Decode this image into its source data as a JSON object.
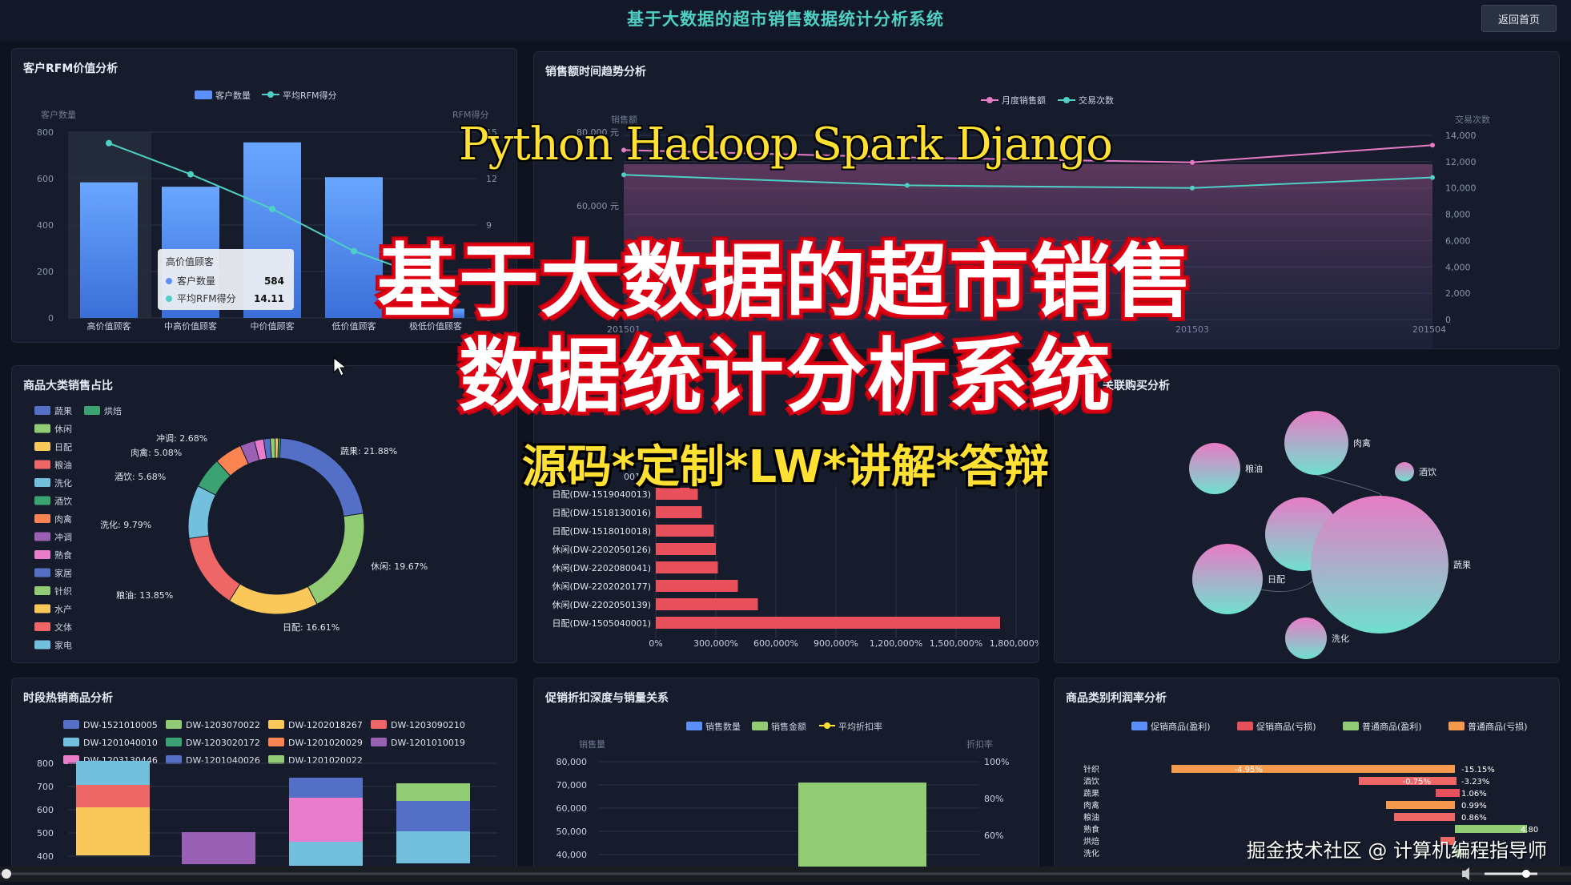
{
  "header": {
    "title": "基于大数据的超市销售数据统计分析系统",
    "home_button": "返回首页"
  },
  "panels": {
    "rfm": {
      "title": "客户RFM价值分析",
      "legend": [
        "客户数量",
        "平均RFM得分"
      ],
      "left_axis_name": "客户数量",
      "right_axis_name": "RFM得分",
      "left_ticks": [
        "800",
        "600",
        "400",
        "200",
        "0"
      ],
      "right_ticks": [
        "15",
        "12",
        "9",
        "6",
        "3"
      ],
      "tooltip": {
        "title": "高价值顾客",
        "row1_label": "客户数量",
        "row1_value": "584",
        "row2_label": "平均RFM得分",
        "row2_value": "14.11"
      }
    },
    "trend": {
      "title": "销售额时间趋势分析",
      "legend": [
        "月度销售额",
        "交易次数"
      ],
      "left_axis_name": "销售额",
      "right_axis_name": "交易次数",
      "left_ticks": [
        "80,000 元",
        "60,000 元"
      ],
      "right_ticks": [
        "14,000",
        "12,000",
        "10,000",
        "8,000",
        "6,000",
        "4,000",
        "2,000",
        "0"
      ],
      "x_ticks": [
        "201501",
        "201503",
        "201504"
      ]
    },
    "category": {
      "title": "商品大类销售占比",
      "legend": [
        "蔬果",
        "烘焙",
        "休闲",
        "日配",
        "粮油",
        "洗化",
        "酒饮",
        "肉禽",
        "冲调",
        "熟食",
        "家居",
        "针织",
        "水产",
        "文体",
        "家电"
      ],
      "labels": [
        "蔬果: 21.88%",
        "休闲: 19.67%",
        "日配: 16.61%",
        "粮油: 13.85%",
        "洗化: 9.79%",
        "酒饮: 5.68%",
        "肉禽: 5.08%",
        "冲调: 2.68%"
      ]
    },
    "top_products": {
      "title_suffix": "0013)",
      "x_ticks": [
        "0%",
        "300,000%",
        "600,000%",
        "900,000%",
        "1,200,000%",
        "1,500,000%",
        "1,800,000%"
      ]
    },
    "bubble": {
      "title": "关联购买分析"
    },
    "hot": {
      "title": "时段热销商品分析",
      "legend": [
        "DW-1521010005",
        "DW-1203070022",
        "DW-1202018267",
        "DW-1203090210",
        "DW-1201040010",
        "DW-1203020172",
        "DW-1201020029",
        "DW-1201010019",
        "DW-1203130446",
        "DW-1201040026",
        "DW-1201020022"
      ],
      "y_ticks": [
        "800",
        "700",
        "600",
        "500",
        "400"
      ]
    },
    "promo": {
      "title": "促销折扣深度与销量关系",
      "legend": [
        "销售数量",
        "销售金额",
        "平均折扣率"
      ],
      "left_axis_name": "销售量",
      "right_axis_name": "折扣率",
      "left_ticks": [
        "80,000",
        "70,000",
        "60,000",
        "50,000",
        "40,000"
      ],
      "right_ticks": [
        "100%",
        "80%",
        "60%"
      ]
    },
    "profit": {
      "title": "商品类别利润率分析",
      "legend": [
        "促销商品(盈利)",
        "促销商品(亏损)",
        "普通商品(盈利)",
        "普通商品(亏损)"
      ],
      "categories": [
        "针织",
        "酒饮",
        "蔬果",
        "肉禽",
        "粮油",
        "熟食",
        "烘焙",
        "洗化"
      ],
      "labels": [
        "-4.95%",
        "-15.15%",
        "-0.75%",
        "-3.23%",
        "1.06%",
        "0.99%",
        "0.86%",
        "4.80"
      ]
    }
  },
  "chart_data": [
    {
      "type": "bar",
      "title": "客户RFM价值分析",
      "categories": [
        "高价值顾客",
        "中高价值顾客",
        "中价值顾客",
        "低价值顾客",
        "极低价值顾客"
      ],
      "series": [
        {
          "name": "客户数量",
          "values": [
            584,
            565,
            756,
            606,
            40
          ]
        },
        {
          "name": "平均RFM得分",
          "values": [
            14.11,
            11.6,
            8.8,
            5.4,
            3.0
          ]
        }
      ],
      "ylim": [
        0,
        800
      ],
      "ylim_right": [
        0,
        15
      ]
    },
    {
      "type": "line",
      "title": "销售额时间趋势分析",
      "x": [
        "201501",
        "201502",
        "201503",
        "201504"
      ],
      "series": [
        {
          "name": "月度销售额",
          "values": [
            84000,
            81000,
            79000,
            86000
          ]
        },
        {
          "name": "交易次数",
          "values": [
            11000,
            10200,
            10000,
            10800
          ]
        }
      ]
    },
    {
      "type": "pie",
      "title": "商品大类销售占比",
      "categories": [
        "蔬果",
        "休闲",
        "日配",
        "粮油",
        "洗化",
        "酒饮",
        "肉禽",
        "冲调",
        "熟食",
        "家居",
        "针织",
        "水产",
        "烘焙"
      ],
      "values": [
        21.88,
        19.67,
        16.61,
        13.85,
        9.79,
        5.68,
        5.08,
        2.68,
        1.7,
        1.2,
        0.9,
        0.6,
        0.4
      ]
    },
    {
      "type": "bar",
      "categories": [
        "日配(DW-1519040013)",
        "日配(DW-1518130016)",
        "日配(DW-1518010018)",
        "休闲(DW-2202050126)",
        "休闲(DW-2202080041)",
        "休闲(DW-2202020177)",
        "休闲(DW-2202050139)",
        "日配(DW-1505040001)"
      ],
      "values": [
        210000,
        230000,
        290000,
        300000,
        310000,
        410000,
        510000,
        1720000
      ],
      "xlim": [
        0,
        1800000
      ]
    },
    {
      "type": "scatter",
      "title": "关联购买分析",
      "categories": [
        "肉禽",
        "粮油",
        "酒饮",
        "休闲",
        "日配",
        "蔬果",
        "洗化"
      ],
      "values": [
        0.5,
        0.55,
        0.3,
        0.46,
        0.6,
        0.57,
        0.54
      ]
    },
    {
      "type": "bar",
      "title": "时段热销商品分析",
      "ylim": [
        400,
        800
      ]
    },
    {
      "type": "bar",
      "title": "促销折扣深度与销量关系",
      "series": [
        {
          "name": "销售金额",
          "values": [
            71000
          ]
        }
      ],
      "ylim": [
        40000,
        80000
      ]
    },
    {
      "type": "bar",
      "title": "商品类别利润率分析",
      "categories": [
        "针织",
        "酒饮",
        "蔬果",
        "肉禽",
        "粮油",
        "熟食",
        "烘焙",
        "洗化"
      ]
    }
  ],
  "overlay": {
    "english": "Python Hadoop Spark Django",
    "chinese_line1": "基于大数据的超市销售",
    "chinese_line2": "数据统计分析系统",
    "subtitle": "源码*定制*LW*讲解*答辩",
    "watermark": "掘金技术社区 @ 计算机编程指导师"
  },
  "colors": {
    "blue": "#5b8ff9",
    "teal": "#4fd0c4",
    "red": "#e8505b",
    "green": "#91cc75",
    "orange": "#f59a4c",
    "pink": "#e87bc5"
  }
}
